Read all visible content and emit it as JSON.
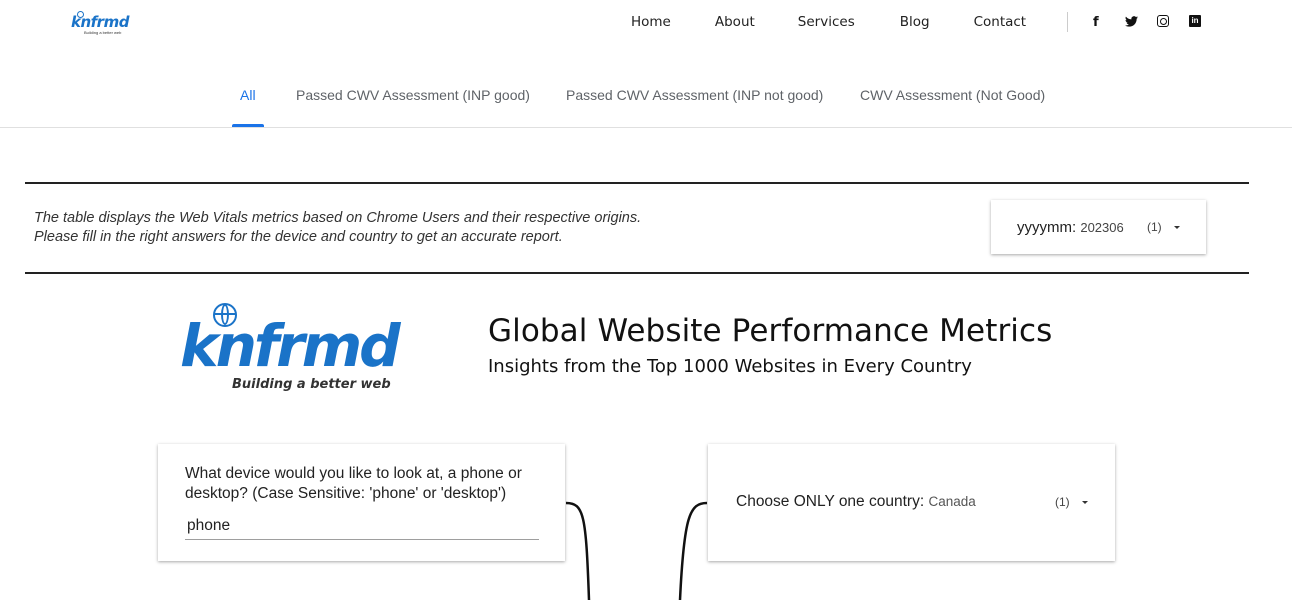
{
  "header": {
    "brand": {
      "name": "knfrmd",
      "tagline": "Building a better web"
    },
    "nav": [
      "Home",
      "About",
      "Services",
      "Blog",
      "Contact"
    ],
    "social": [
      {
        "name": "facebook",
        "glyph": "f"
      },
      {
        "name": "twitter",
        "glyph": "🐦"
      },
      {
        "name": "instagram",
        "glyph": ""
      },
      {
        "name": "linkedin",
        "glyph": "in"
      }
    ]
  },
  "tabs": [
    {
      "label": "All",
      "active": true
    },
    {
      "label": "Passed CWV Assessment (INP good)",
      "active": false
    },
    {
      "label": "Passed CWV Assessment (INP not good)",
      "active": false
    },
    {
      "label": "CWV Assessment (Not Good)",
      "active": false
    }
  ],
  "info": {
    "line1": "The table displays the Web Vitals metrics based on Chrome Users and their respective origins.",
    "line2": "Please fill in the right answers for the device and country to get an accurate report."
  },
  "date_filter": {
    "label": "yyyymm",
    "value": "202306",
    "count": "(1)"
  },
  "hero": {
    "logo_word": "knfrmd",
    "logo_tagline": "Building a better web",
    "title": "Global Website Performance Metrics",
    "subtitle": "Insights from the Top 1000 Websites in Every Country"
  },
  "device_param": {
    "question": "What device would you like to look at, a phone or desktop? (Case Sensitive: 'phone' or 'desktop')",
    "value": "phone"
  },
  "country_filter": {
    "label": "Choose ONLY one country",
    "value": "Canada",
    "count": "(1)"
  },
  "colors": {
    "accent": "#1a73e8",
    "brand": "#1a73c8"
  }
}
